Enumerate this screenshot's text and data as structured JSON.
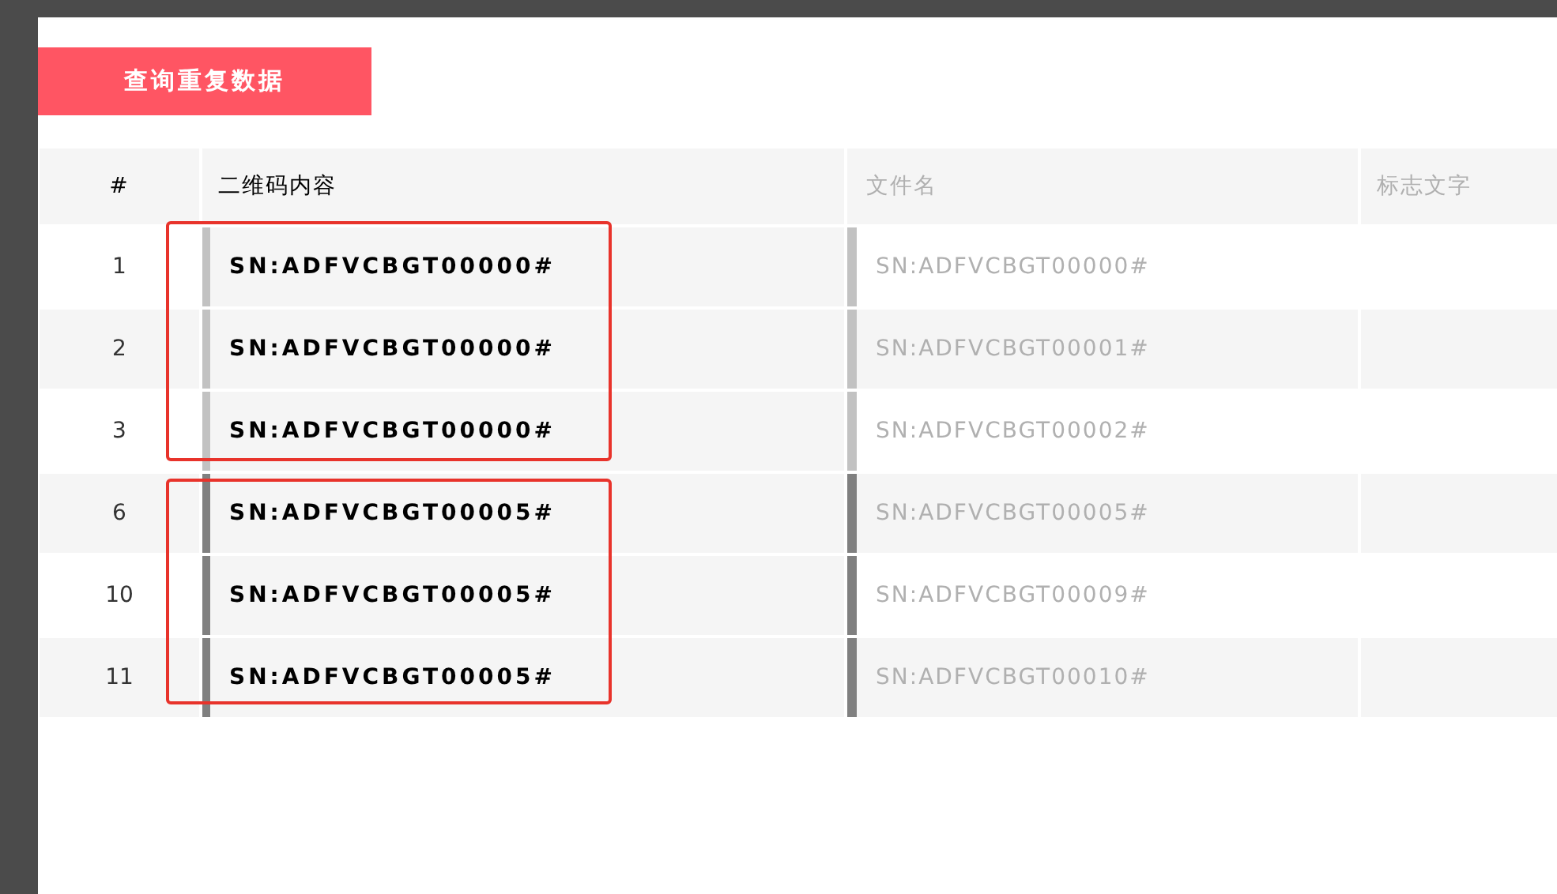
{
  "dialog": {
    "query_button": "查询重复数据",
    "table": {
      "columns": [
        "#",
        "二维码内容",
        "文件名",
        "标志文字"
      ],
      "groups": [
        {
          "color": "#c2c2c2",
          "rows": [
            {
              "index": "1",
              "code": "SN:ADFVCBGT00000#",
              "file": "SN:ADFVCBGT00000#"
            },
            {
              "index": "2",
              "code": "SN:ADFVCBGT00000#",
              "file": "SN:ADFVCBGT00001#"
            },
            {
              "index": "3",
              "code": "SN:ADFVCBGT00000#",
              "file": "SN:ADFVCBGT00002#"
            }
          ]
        },
        {
          "color": "#808080",
          "rows": [
            {
              "index": "6",
              "code": "SN:ADFVCBGT00005#",
              "file": "SN:ADFVCBGT00005#"
            },
            {
              "index": "10",
              "code": "SN:ADFVCBGT00005#",
              "file": "SN:ADFVCBGT00009#"
            },
            {
              "index": "11",
              "code": "SN:ADFVCBGT00005#",
              "file": "SN:ADFVCBGT00010#"
            }
          ]
        }
      ]
    }
  }
}
